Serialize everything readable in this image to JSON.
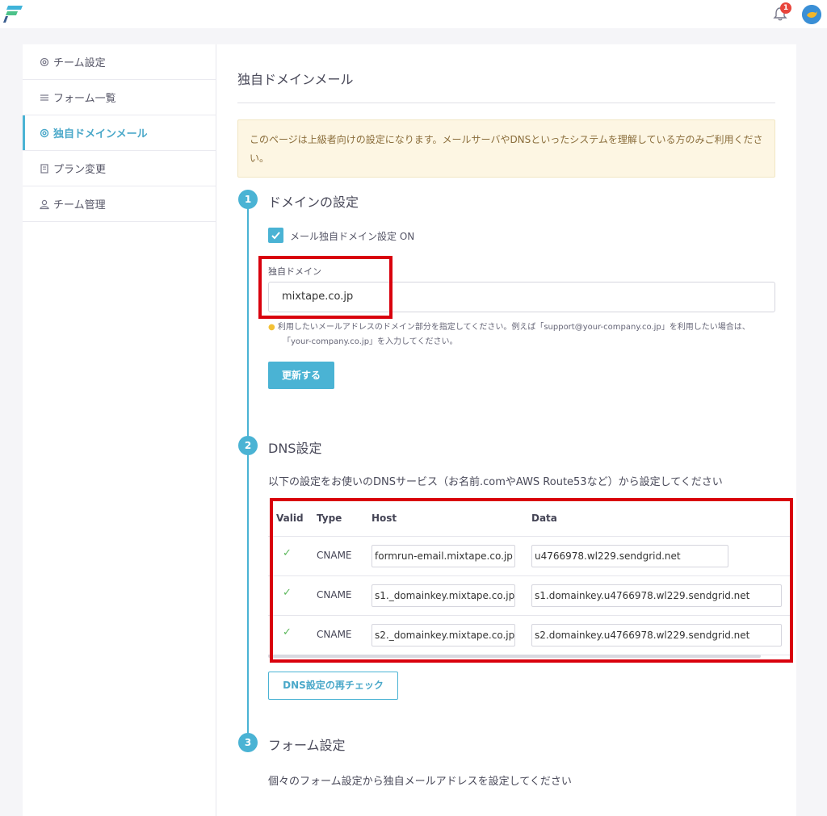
{
  "header": {
    "notification_count": "1"
  },
  "sidebar": {
    "items": [
      {
        "label": "チーム設定",
        "icon": "gear-icon"
      },
      {
        "label": "フォーム一覧",
        "icon": "list-icon"
      },
      {
        "label": "独自ドメインメール",
        "icon": "gear-icon"
      },
      {
        "label": "プラン変更",
        "icon": "document-icon"
      },
      {
        "label": "チーム管理",
        "icon": "user-icon"
      }
    ],
    "active_index": 2
  },
  "page": {
    "title": "独自ドメインメール",
    "notice": "このページは上級者向けの設定になります。メールサーバやDNSといったシステムを理解している方のみご利用ください。"
  },
  "steps": [
    {
      "number": "1",
      "title": "ドメインの設定"
    },
    {
      "number": "2",
      "title": "DNS設定"
    },
    {
      "number": "3",
      "title": "フォーム設定"
    }
  ],
  "domain": {
    "checkbox_label": "メール独自ドメイン設定 ON",
    "checked": true,
    "field_label": "独自ドメイン",
    "value": "mixtape.co.jp",
    "hint_line1": "利用したいメールアドレスのドメイン部分を指定してください。例えば「support@your-company.co.jp」を利用したい場合は、",
    "hint_line2": "「your-company.co.jp」を入力してください。",
    "update_button": "更新する"
  },
  "dns": {
    "description": "以下の設定をお使いのDNSサービス（お名前.comやAWS Route53など）から設定してください",
    "columns": [
      "Valid",
      "Type",
      "Host",
      "Data"
    ],
    "rows": [
      {
        "valid": "✓",
        "type": "CNAME",
        "host": "formrun-email.mixtape.co.jp",
        "data": "u4766978.wl229.sendgrid.net"
      },
      {
        "valid": "✓",
        "type": "CNAME",
        "host": "s1._domainkey.mixtape.co.jp",
        "data": "s1.domainkey.u4766978.wl229.sendgrid.net"
      },
      {
        "valid": "✓",
        "type": "CNAME",
        "host": "s2._domainkey.mixtape.co.jp",
        "data": "s2.domainkey.u4766978.wl229.sendgrid.net"
      }
    ],
    "recheck_button": "DNS設定の再チェック"
  },
  "form_settings": {
    "description": "個々のフォーム設定から独自メールアドレスを設定してください"
  },
  "colors": {
    "accent": "#4ab3d4",
    "highlight_box": "#d9000d",
    "notice_bg": "#fdf6e3",
    "valid_check": "#5cb85c"
  }
}
